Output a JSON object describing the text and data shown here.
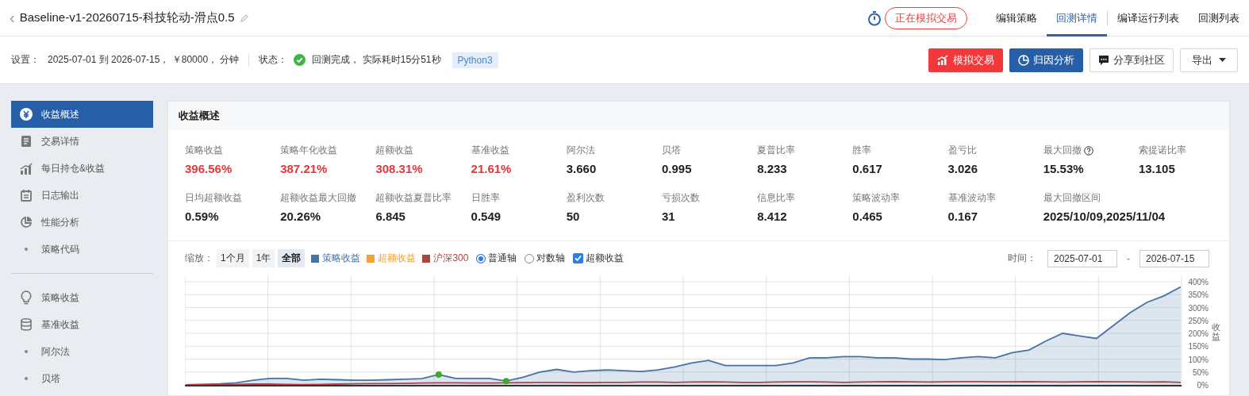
{
  "header": {
    "back": "‹",
    "title": "Baseline-v1-20260715-科技轮动-滑点0.5",
    "live_button": "正在模拟交易",
    "tabs": [
      {
        "label": "编辑策略",
        "selected": false
      },
      {
        "label": "回测详情",
        "selected": true
      },
      {
        "label": "编译运行列表",
        "selected": false
      },
      {
        "label": "回测列表",
        "selected": false
      }
    ]
  },
  "settings": {
    "label": "设置：",
    "value": "2025-07-01 到 2026-07-15，  ￥80000，  分钟",
    "status_label": "状态：",
    "status": "回测完成， 实际耗时15分51秒",
    "language": "Python3"
  },
  "actions": [
    {
      "label": "模拟交易",
      "kind": "danger"
    },
    {
      "label": "归因分析",
      "kind": "primary"
    },
    {
      "label": "分享到社区",
      "kind": "default"
    },
    {
      "label": "导出",
      "kind": "dropdown"
    }
  ],
  "sidebar": {
    "items": [
      {
        "label": "收益概述",
        "kind": "icon",
        "selected": true
      },
      {
        "label": "交易详情",
        "kind": "icon",
        "selected": false
      },
      {
        "label": "每日持仓&收益",
        "kind": "icon",
        "selected": false
      },
      {
        "label": "日志输出",
        "kind": "icon",
        "selected": false
      },
      {
        "label": "性能分析",
        "kind": "icon",
        "selected": false
      },
      {
        "label": "策略代码",
        "kind": "bullet",
        "selected": false
      },
      {
        "label": "策略收益",
        "kind": "icon",
        "selected": false
      },
      {
        "label": "基准收益",
        "kind": "icon",
        "selected": false
      },
      {
        "label": "阿尔法",
        "kind": "bullet",
        "selected": false
      },
      {
        "label": "贝塔",
        "kind": "bullet",
        "selected": false
      }
    ]
  },
  "panel": {
    "title": "收益概述",
    "metrics": [
      {
        "label": "策略收益",
        "value": "396.56%",
        "highlight": true,
        "help": false
      },
      {
        "label": "策略年化收益",
        "value": "387.21%",
        "highlight": true,
        "help": false
      },
      {
        "label": "超额收益",
        "value": "308.31%",
        "highlight": true,
        "help": false
      },
      {
        "label": "基准收益",
        "value": "21.61%",
        "highlight": true,
        "help": false
      },
      {
        "label": "阿尔法",
        "value": "3.660",
        "highlight": false,
        "help": false
      },
      {
        "label": "贝塔",
        "value": "0.995",
        "highlight": false,
        "help": false
      },
      {
        "label": "夏普比率",
        "value": "8.233",
        "highlight": false,
        "help": false
      },
      {
        "label": "胜率",
        "value": "0.617",
        "highlight": false,
        "help": false
      },
      {
        "label": "盈亏比",
        "value": "3.026",
        "highlight": false,
        "help": false
      },
      {
        "label": "最大回撤",
        "value": "15.53%",
        "highlight": false,
        "help": true
      },
      {
        "label": "索提诺比率",
        "value": "13.105",
        "highlight": false,
        "help": false
      },
      {
        "label": "日均超额收益",
        "value": "0.59%",
        "highlight": false,
        "help": false
      },
      {
        "label": "超额收益最大回撤",
        "value": "20.26%",
        "highlight": false,
        "help": false
      },
      {
        "label": "超额收益夏普比率",
        "value": "6.845",
        "highlight": false,
        "help": false
      },
      {
        "label": "日胜率",
        "value": "0.549",
        "highlight": false,
        "help": false
      },
      {
        "label": "盈利次数",
        "value": "50",
        "highlight": false,
        "help": false
      },
      {
        "label": "亏损次数",
        "value": "31",
        "highlight": false,
        "help": false
      },
      {
        "label": "信息比率",
        "value": "8.412",
        "highlight": false,
        "help": false
      },
      {
        "label": "策略波动率",
        "value": "0.465",
        "highlight": false,
        "help": false
      },
      {
        "label": "基准波动率",
        "value": "0.167",
        "highlight": false,
        "help": false
      },
      {
        "label": "最大回撤区间",
        "value": "2025/10/09,2025/11/04",
        "highlight": false,
        "help": false
      }
    ],
    "chart_toolbar": {
      "zoom_label": "缩放：",
      "zoom_options": [
        {
          "label": "1个月",
          "selected": false
        },
        {
          "label": "1年",
          "selected": false
        },
        {
          "label": "全部",
          "selected": true
        }
      ],
      "legend": [
        {
          "label": "超额收益",
          "color": "#f7a035"
        }
      ],
      "axis_options": [
        {
          "label": "普通轴",
          "selected": true
        },
        {
          "label": "对数轴",
          "selected": false
        }
      ],
      "excess_toggle": {
        "label": "超额收益",
        "checked": true
      },
      "time_label": "时间：",
      "start": "2025-07-01",
      "separator": "-",
      "end": "2026-07-15"
    },
    "chart_data": {
      "type": "line",
      "grid": true,
      "ylabel": "收益",
      "ylim": [
        0,
        400
      ],
      "yticks": [
        {
          "value": 0,
          "label": "0%"
        },
        {
          "value": 50,
          "label": "50%"
        },
        {
          "value": 100,
          "label": "100%"
        },
        {
          "value": 150,
          "label": "150%"
        },
        {
          "value": 200,
          "label": "200%"
        },
        {
          "value": 250,
          "label": "250%"
        },
        {
          "value": 300,
          "label": "300%"
        },
        {
          "value": 350,
          "label": "350%"
        },
        {
          "value": 400,
          "label": "400%"
        }
      ],
      "series": [
        {
          "name": "策略收益",
          "color": "#4572a7",
          "type": "area",
          "values": [
            0,
            2,
            4,
            8,
            18,
            25,
            25,
            18,
            22,
            20,
            18,
            18,
            20,
            22,
            24,
            40,
            25,
            25,
            25,
            15,
            30,
            50,
            60,
            50,
            55,
            58,
            55,
            52,
            58,
            70,
            85,
            95,
            75,
            75,
            75,
            75,
            85,
            105,
            105,
            110,
            110,
            105,
            105,
            100,
            100,
            98,
            105,
            110,
            105,
            125,
            135,
            170,
            200,
            190,
            180,
            230,
            280,
            320,
            345,
            380
          ]
        },
        {
          "name": "沪深300",
          "color": "#aa4643",
          "type": "line",
          "values": [
            0,
            1,
            2,
            2,
            3,
            3,
            2,
            1,
            2,
            3,
            4,
            5,
            5,
            6,
            7,
            8,
            8,
            7,
            7,
            8,
            9,
            10,
            10,
            9,
            9,
            10,
            10,
            11,
            11,
            10,
            11,
            12,
            11,
            10,
            10,
            11,
            12,
            12,
            11,
            10,
            11,
            12,
            13,
            12,
            11,
            12,
            13,
            13,
            12,
            12,
            13,
            12,
            11,
            12,
            13,
            12,
            12,
            11,
            12,
            10
          ]
        }
      ]
    }
  }
}
